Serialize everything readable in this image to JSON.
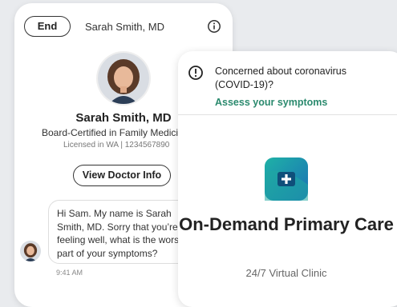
{
  "chat": {
    "end_label": "End",
    "title": "Sarah Smith, MD",
    "doctor_name": "Sarah Smith, MD",
    "certification": "Board-Certified in Family Medicine",
    "license": "Licensed in WA | 1234567890",
    "view_button": "View Doctor Info",
    "message": "Hi Sam. My name is Sarah Smith, MD. Sorry that you’re not feeling well, what is the worst part of your symptoms?",
    "time": "9:41 AM"
  },
  "covid": {
    "text": "Concerned about coronavirus (COVID-19)?",
    "link": "Assess your symptoms"
  },
  "primary_care": {
    "title": "On-Demand Primary Care",
    "subtitle": "24/7 Virtual Clinic"
  },
  "colors": {
    "accent": "#2b8a6e",
    "icon_teal": "#1fa7a0",
    "icon_blue": "#1d6fb8"
  },
  "icons": {
    "info": "info-icon",
    "alert": "alert-circle-icon",
    "app": "medical-cross-app-icon"
  }
}
